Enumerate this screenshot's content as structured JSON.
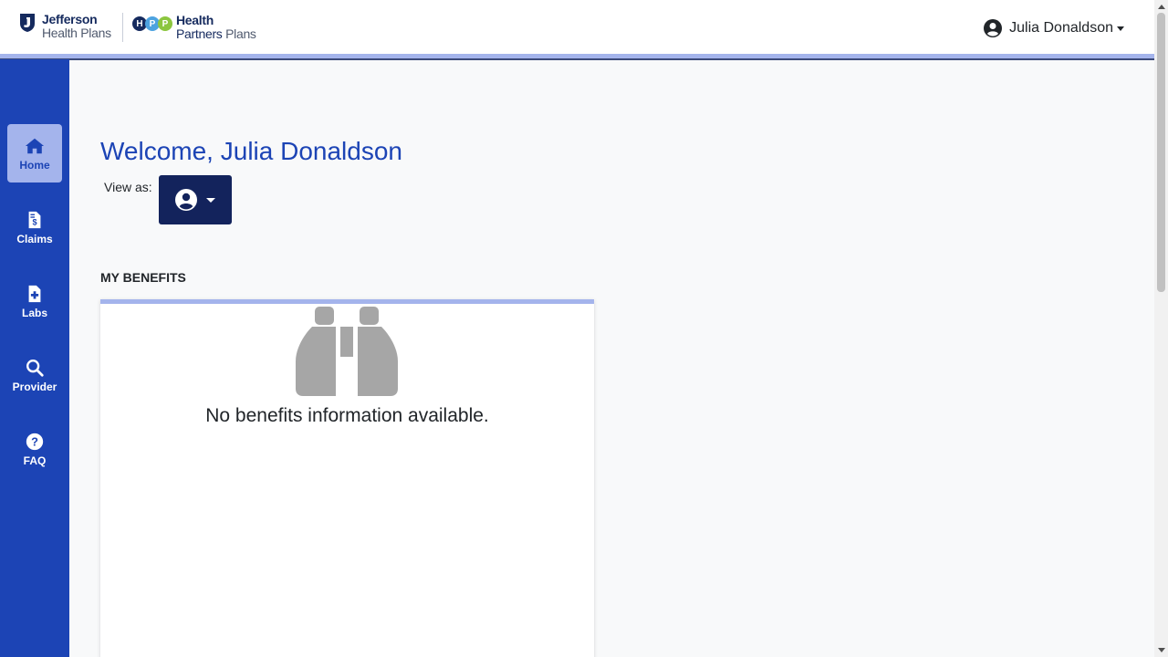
{
  "header": {
    "logo_jefferson_line1": "Jefferson",
    "logo_jefferson_line2": "Health Plans",
    "logo_hpp_letters": [
      "H",
      "P",
      "P"
    ],
    "logo_hpp_line1": "Health",
    "logo_hpp_line2a": "Partners",
    "logo_hpp_line2b": "Plans",
    "user_name": "Julia Donaldson",
    "user_icon": "user-circle-icon"
  },
  "sidebar": {
    "items": [
      {
        "label": "Home",
        "icon": "home-icon",
        "active": true
      },
      {
        "label": "Claims",
        "icon": "file-invoice-dollar-icon",
        "active": false
      },
      {
        "label": "Labs",
        "icon": "file-medical-icon",
        "active": false
      },
      {
        "label": "Provider",
        "icon": "search-icon",
        "active": false
      },
      {
        "label": "FAQ",
        "icon": "question-circle-icon",
        "active": false
      }
    ]
  },
  "main": {
    "welcome": "Welcome, Julia Donaldson",
    "view_as_label": "View as:",
    "section_title": "MY BENEFITS",
    "empty_message": "No benefits information available.",
    "empty_icon": "binoculars-icon"
  },
  "colors": {
    "sidebar": "#1c44b5",
    "sidebar_active": "#a4b4ec",
    "view_as_button": "#13235c",
    "accent_line": "#a4b4ec",
    "welcome_text": "#1c44b5"
  }
}
